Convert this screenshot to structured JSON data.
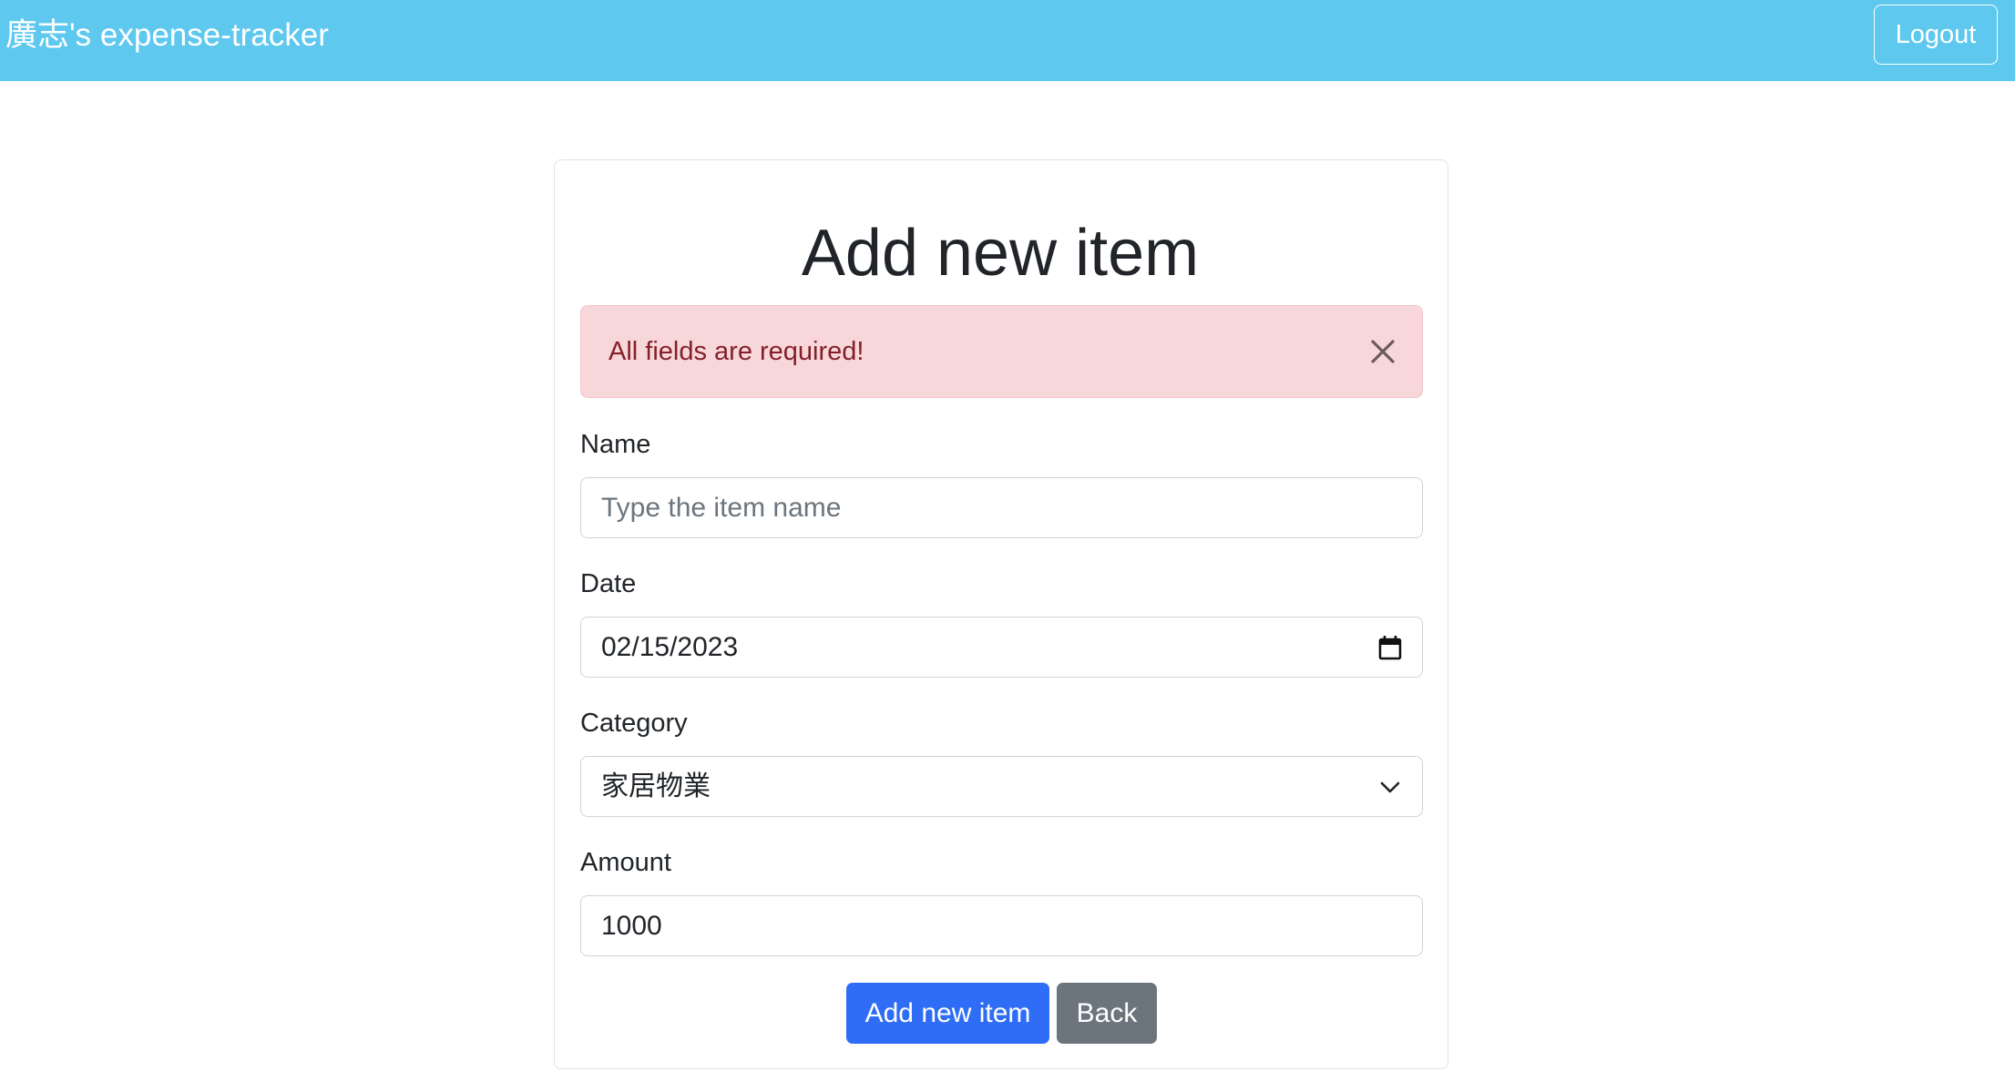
{
  "navbar": {
    "brand": "廣志's expense-tracker",
    "logout_label": "Logout",
    "background_color": "#5ec8ee"
  },
  "form": {
    "title": "Add new item",
    "alert": {
      "message": "All fields are required!",
      "close_icon": "close-icon",
      "color": "#f8d7da"
    },
    "name": {
      "label": "Name",
      "placeholder": "Type the item name",
      "value": ""
    },
    "date": {
      "label": "Date",
      "value": "02/15/2023",
      "icon": "calendar-icon"
    },
    "category": {
      "label": "Category",
      "selected": "家居物業",
      "icon": "chevron-down-icon"
    },
    "amount": {
      "label": "Amount",
      "value": "1000"
    },
    "submit_label": "Add new item",
    "back_label": "Back",
    "primary_color": "#2f6df6",
    "secondary_color": "#6c757d"
  }
}
